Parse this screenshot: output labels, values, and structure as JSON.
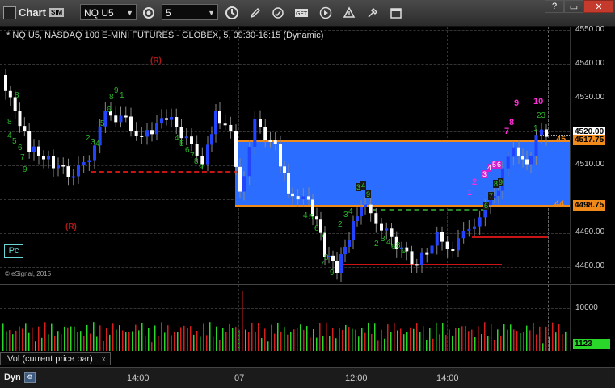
{
  "window": {
    "title": "Chart",
    "sim_badge": "SIM",
    "symbol_value": "NQ U5",
    "interval_value": "5",
    "buttons": [
      "help-icon",
      "restore-icon",
      "close-icon"
    ]
  },
  "toolbar": {
    "icons": [
      "settings-gear-icon",
      "clock-icon",
      "pencil-icon",
      "refresh-icon",
      "get-icon",
      "play-icon",
      "alert-icon",
      "tools-icon",
      "calendar-icon"
    ]
  },
  "chart": {
    "header": "* NQ U5, NASDAQ 100 E-MINI FUTURES - GLOBEX, 5, 09:30-16:15 (Dynamic)",
    "copyright": "© eSignal, 2015",
    "pc_label": "Pc",
    "r_labels": [
      "(R)",
      "(R)"
    ],
    "price_ticks": [
      "4550.00",
      "4540.00",
      "4530.00",
      "4520.00",
      "4510.00",
      "4500.00",
      "4490.00",
      "4480.00"
    ],
    "last_price_tag": "4520.00",
    "zone_top_tag": "4517.75",
    "zone_bottom_tag": "4498.75",
    "zone_top_label_partial": "45",
    "zone_bottom_label_partial": "44",
    "time_labels": [
      "14:00",
      "07",
      "12:00",
      "14:00"
    ],
    "dyn_label": "Dyn",
    "setup_counts_green": [
      "8",
      "9",
      "4",
      "5",
      "6",
      "7",
      "8",
      "9",
      "1",
      "2",
      "3",
      "4",
      "5",
      "6",
      "7",
      "8",
      "9",
      "1",
      "2",
      "3",
      "4",
      "5",
      "6",
      "7",
      "8",
      "9",
      "2",
      "3",
      "4",
      "6",
      "8",
      "9",
      "1",
      "2",
      "3",
      "4",
      "5",
      "6",
      "7",
      "8",
      "9",
      "1",
      "23",
      "1"
    ],
    "setup_counts_magenta": [
      "9",
      "10",
      "8",
      "7",
      "1",
      "2",
      "3",
      "4",
      "5",
      "6"
    ],
    "chart_colors": {
      "up_bar": "#2244ff",
      "down_bar": "#ffffff",
      "zone": "#2a6dff",
      "zone_line": "#f08a1a",
      "support": "#c81414"
    }
  },
  "volume": {
    "label": "Vol (current price bar)",
    "close": "x",
    "tick": "10000",
    "last_volume_tag": "1123"
  }
}
